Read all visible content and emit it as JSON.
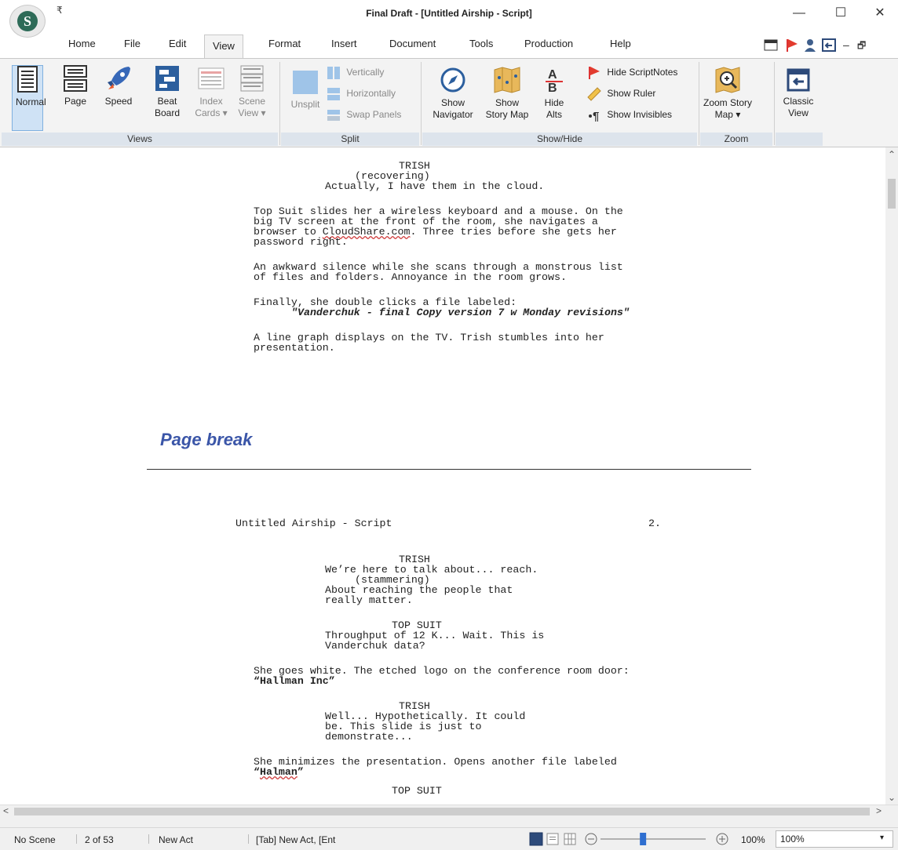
{
  "window": {
    "title": "Final Draft - [Untitled Airship - Script]",
    "qat_symbol": "₹",
    "minimize": "—",
    "maximize": "☐",
    "close": "✕"
  },
  "app_logo_letter": "S",
  "menu_tabs": [
    "Home",
    "File",
    "Edit",
    "View",
    "Format",
    "Insert",
    "Document",
    "Tools",
    "Production",
    "Help"
  ],
  "active_tab": "View",
  "ribbon": {
    "views": {
      "label": "Views",
      "normal": "Normal",
      "page": "Page",
      "speed": "Speed",
      "beat_board": [
        "Beat",
        "Board"
      ],
      "index_cards": [
        "Index",
        "Cards ▾"
      ],
      "scene_view": [
        "Scene",
        "View ▾"
      ]
    },
    "split": {
      "label": "Split",
      "unsplit": "Unsplit",
      "vertically": "Vertically",
      "horizontally": "Horizontally",
      "swap_panels": "Swap Panels"
    },
    "showhide": {
      "label": "Show/Hide",
      "show_navigator": [
        "Show",
        "Navigator"
      ],
      "show_story_map": [
        "Show",
        "Story Map"
      ],
      "hide_alts": [
        "Hide",
        "Alts"
      ],
      "hide_scriptnotes": "Hide ScriptNotes",
      "show_ruler": "Show Ruler",
      "show_invisibles": "Show Invisibles"
    },
    "zoom": {
      "label": "Zoom",
      "zoom_story_map": [
        "Zoom Story",
        "Map ▾"
      ]
    },
    "classic": [
      "Classic",
      "View"
    ]
  },
  "script": {
    "p1_char": "TRISH",
    "p1_paren": "(recovering)",
    "p1_dialogue": "Actually, I have them in the cloud.",
    "a1": [
      "Top Suit slides her a wireless keyboard and a mouse. On the",
      "big TV screen at the front of the room, she navigates a",
      "browser to ",
      "CloudShare.com",
      ". Three tries before she gets her",
      "password right."
    ],
    "a2": [
      "An awkward silence while she scans through a monstrous list",
      "of files and folders. Annoyance in the room grows."
    ],
    "a3": "Finally, she double clicks a file labeled:",
    "a3_file": "\"Vanderchuk - final Copy version 7 w Monday revisions\"",
    "a4": [
      "A line graph displays on the TV. Trish stumbles into her",
      "presentation."
    ],
    "page_break": "Page break",
    "header_title": "Untitled Airship - Script",
    "header_page": "2.",
    "d1_char": "TRISH",
    "d1_line1": "We’re here to talk about... reach.",
    "d1_paren": "(stammering)",
    "d1_line2": "About reaching the people that",
    "d1_line3": "really matter.",
    "d2_char": "TOP SUIT",
    "d2_line1": "Throughput of 12 K... Wait. This is",
    "d2_line2": "Vanderchuk data?",
    "a5": "She goes white. The etched logo on the conference room door:",
    "a5_bold": "“Hallman Inc”",
    "d3_char": "TRISH",
    "d3_line1": "Well... Hypothetically. It could",
    "d3_line2": "be. This slide is just to",
    "d3_line3": "demonstrate...",
    "a6": "She minimizes the presentation. Opens another file labeled",
    "a6_bold_q1": "“",
    "a6_bold_word": "Halman",
    "a6_bold_q2": "”",
    "cut_char": "TOP SUIT"
  },
  "status": {
    "scene": "No Scene",
    "page": "2 of 53",
    "act": "New Act",
    "tab_hint": "[Tab] New Act, [Ent",
    "zoom_pct": "100%",
    "zoom_value": "100%",
    "zoom_level": 1.0
  }
}
